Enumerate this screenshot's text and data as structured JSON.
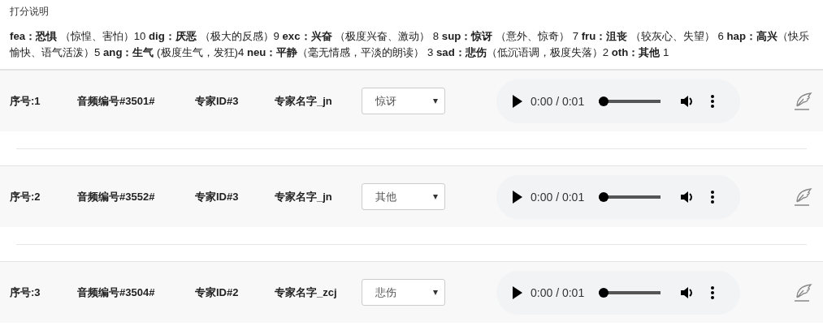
{
  "instructions": {
    "title": "打分说明",
    "text": "**fea：恐惧** （惊惶、害怕）10 **dig：厌恶** （极大的反感）9 **exc：兴奋** （极度兴奋、激动） 8 **sup：惊讶** （意外、惊奇） 7 **fru：沮丧** （较灰心、失望） 6 **hap：高兴**（快乐愉快、语气活泼）5 **ang：生气** (极度生气，发狂)4 **neu：平静**（毫无情感，平淡的朗读） 3 **sad：悲伤**（低沉语调，极度失落）2 **oth：其他** 1"
  },
  "rows": [
    {
      "index": "序号:1",
      "audio_id": "音频编号#3501#",
      "expert_id": "专家ID#3",
      "expert_name": "专家名字_jn",
      "emotion": "惊讶",
      "player": {
        "time": "0:00 / 0:01",
        "level": 0
      }
    },
    {
      "index": "序号:2",
      "audio_id": "音频编号#3552#",
      "expert_id": "专家ID#3",
      "expert_name": "专家名字_jn",
      "emotion": "其他",
      "player": {
        "time": "0:00 / 0:01",
        "level": 0
      }
    },
    {
      "index": "序号:3",
      "audio_id": "音频编号#3504#",
      "expert_id": "专家ID#2",
      "expert_name": "专家名字_zcj",
      "emotion": "悲伤",
      "player": {
        "time": "0:00 / 0:01",
        "level": 0
      }
    }
  ]
}
